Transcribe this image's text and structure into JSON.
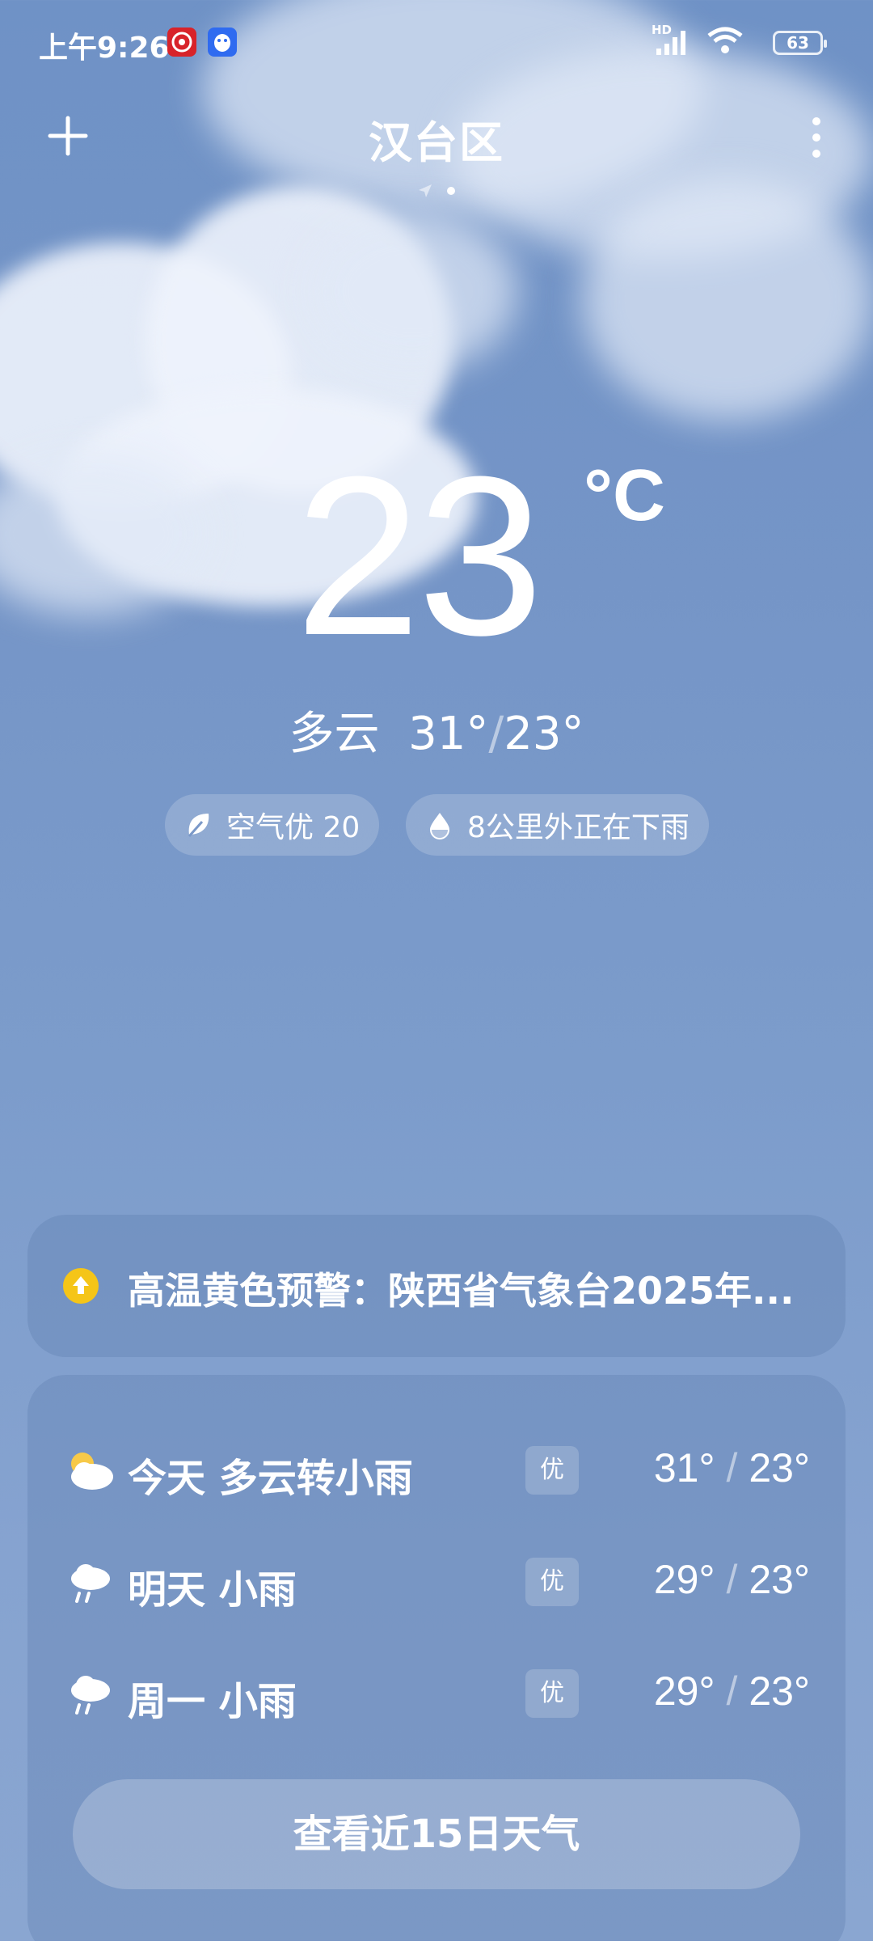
{
  "status_bar": {
    "time": "上午9:26",
    "battery": "63",
    "network_label": "HD"
  },
  "header": {
    "title": "汉台区"
  },
  "current": {
    "temperature": "23",
    "unit": "°C",
    "condition": "多云",
    "high": "31°",
    "low": "23°",
    "separator": "/"
  },
  "pills": {
    "air_quality": "空气优 20",
    "rain_notice": "8公里外正在下雨"
  },
  "warning": {
    "text": "高温黄色预警：陕西省气象台2025年...",
    "color": "#f5c518"
  },
  "forecast": {
    "days": [
      {
        "label": "今天  多云转小雨",
        "aqi": "优",
        "high": "31°",
        "low": "23°",
        "icon": "cloudy-sun-icon"
      },
      {
        "label": "明天  小雨",
        "aqi": "优",
        "high": "29°",
        "low": "23°",
        "icon": "light-rain-icon"
      },
      {
        "label": "周一  小雨",
        "aqi": "优",
        "high": "29°",
        "low": "23°",
        "icon": "light-rain-icon"
      }
    ],
    "separator": "/",
    "button_label": "查看近15日天气"
  }
}
